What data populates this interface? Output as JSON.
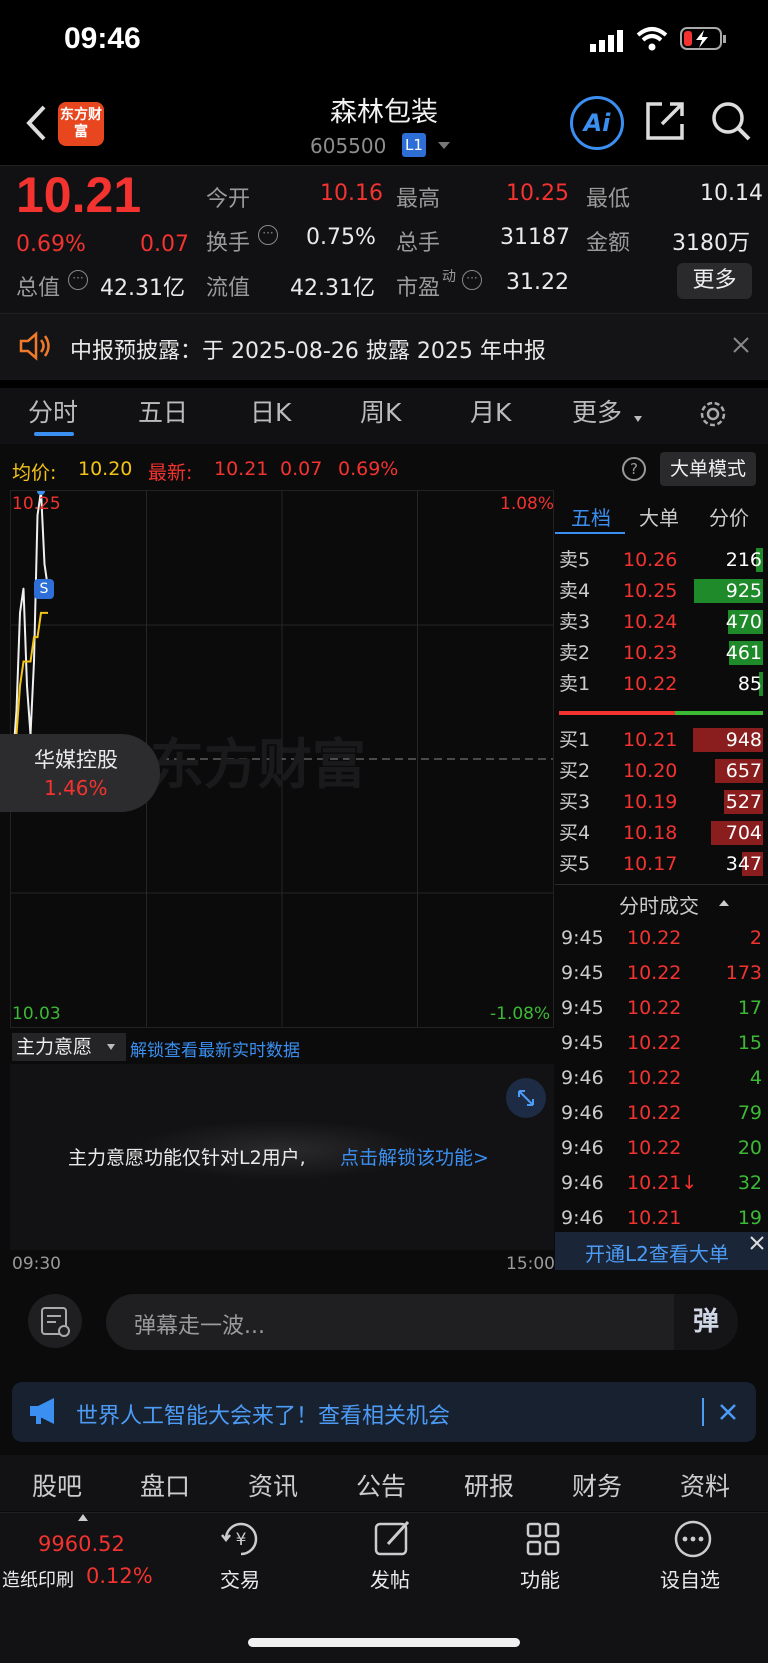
{
  "status": {
    "time": "09:46"
  },
  "header": {
    "logo_text": "东方财富",
    "title": "森林包装",
    "code": "605500",
    "level": "L1",
    "ai": "Ai"
  },
  "quote": {
    "price": "10.21",
    "pct": "0.69%",
    "change": "0.07",
    "open_label": "今开",
    "open": "10.16",
    "high_label": "最高",
    "high": "10.25",
    "low_label": "最低",
    "low": "10.14",
    "turnover_label": "换手",
    "turnover": "0.75%",
    "volume_label": "总手",
    "volume": "31187",
    "amount_label": "金额",
    "amount": "3180万",
    "mcap_label": "总值",
    "mcap": "42.31亿",
    "float_label": "流值",
    "float": "42.31亿",
    "pe_label": "市盈",
    "pe_sup": "动",
    "pe": "31.22",
    "more": "更多"
  },
  "notice": {
    "text": "中报预披露：于 2025-08-26 披露 2025 年中报"
  },
  "tabs": [
    "分时",
    "五日",
    "日K",
    "周K",
    "月K",
    "更多"
  ],
  "chart_info": {
    "avg_label": "均价:",
    "avg": "10.20",
    "latest_label": "最新:",
    "latest": "10.21",
    "chg": "0.07",
    "pct": "0.69%",
    "bigorder_btn": "大单模式"
  },
  "chart_data": {
    "type": "line",
    "y_top_label": "10.25",
    "y_bottom_label": "10.03",
    "pct_top": "1.08%",
    "pct_bottom": "-1.08%",
    "x_start": "09:30",
    "x_end": "15:00",
    "series": [
      {
        "color": "#f0f0f0",
        "values": [
          10.14,
          10.16,
          10.2,
          10.21,
          10.17,
          10.15,
          10.18,
          10.24,
          10.25,
          10.22,
          10.21
        ]
      },
      {
        "color": "#f3c316",
        "values": [
          10.14,
          10.15,
          10.17,
          10.18,
          10.18,
          10.18,
          10.19,
          10.19,
          10.2,
          10.2,
          10.2
        ]
      }
    ],
    "marker": "S",
    "overlay_name": "华媒控股",
    "overlay_pct": "1.46%"
  },
  "orderbook": {
    "tabs": [
      "五档",
      "大单",
      "分价"
    ],
    "sell": [
      {
        "label": "卖5",
        "price": "10.26",
        "vol": "216",
        "frac": 0.1
      },
      {
        "label": "卖4",
        "price": "10.25",
        "vol": "925",
        "frac": 0.98
      },
      {
        "label": "卖3",
        "price": "10.24",
        "vol": "470",
        "frac": 0.5
      },
      {
        "label": "卖2",
        "price": "10.23",
        "vol": "461",
        "frac": 0.49
      },
      {
        "label": "卖1",
        "price": "10.22",
        "vol": "85",
        "frac": 0.06
      }
    ],
    "buy": [
      {
        "label": "买1",
        "price": "10.21",
        "vol": "948",
        "frac": 1.0
      },
      {
        "label": "买2",
        "price": "10.20",
        "vol": "657",
        "frac": 0.69
      },
      {
        "label": "买3",
        "price": "10.19",
        "vol": "527",
        "frac": 0.55
      },
      {
        "label": "买4",
        "price": "10.18",
        "vol": "704",
        "frac": 0.74
      },
      {
        "label": "买5",
        "price": "10.17",
        "vol": "347",
        "frac": 0.3
      }
    ],
    "trades_title": "分时成交",
    "trades": [
      {
        "t": "9:45",
        "p": "10.22",
        "v": "2",
        "c": "red"
      },
      {
        "t": "9:45",
        "p": "10.22",
        "v": "173",
        "c": "red"
      },
      {
        "t": "9:45",
        "p": "10.22",
        "v": "17",
        "c": "green"
      },
      {
        "t": "9:45",
        "p": "10.22",
        "v": "15",
        "c": "green"
      },
      {
        "t": "9:46",
        "p": "10.22",
        "v": "4",
        "c": "green"
      },
      {
        "t": "9:46",
        "p": "10.22",
        "v": "79",
        "c": "green"
      },
      {
        "t": "9:46",
        "p": "10.22",
        "v": "20",
        "c": "green"
      },
      {
        "t": "9:46",
        "p": "10.21↓",
        "v": "32",
        "c": "green"
      },
      {
        "t": "9:46",
        "p": "10.21",
        "v": "19",
        "c": "green"
      }
    ],
    "l2_link": "开通L2查看大单"
  },
  "zhuli": {
    "label": "主力意愿",
    "unlock": "解锁查看最新实时数据",
    "msg": "主力意愿功能仅针对L2用户,",
    "msg_link": "点击解锁该功能>"
  },
  "danmu": {
    "placeholder": "弹幕走一波...",
    "send": "弹"
  },
  "banner": {
    "text": "世界人工智能大会来了！查看相关机会"
  },
  "bottom_tabs": [
    "股吧",
    "盘口",
    "资讯",
    "公告",
    "研报",
    "财务",
    "资料"
  ],
  "bottom_bar": {
    "index_value": "9960.52",
    "index_name": "造纸印刷",
    "index_pct": "0.12%",
    "trade": "交易",
    "post": "发帖",
    "func": "功能",
    "watch": "设自选",
    "trade_glyph": "¥"
  },
  "watermark": "东方财富"
}
